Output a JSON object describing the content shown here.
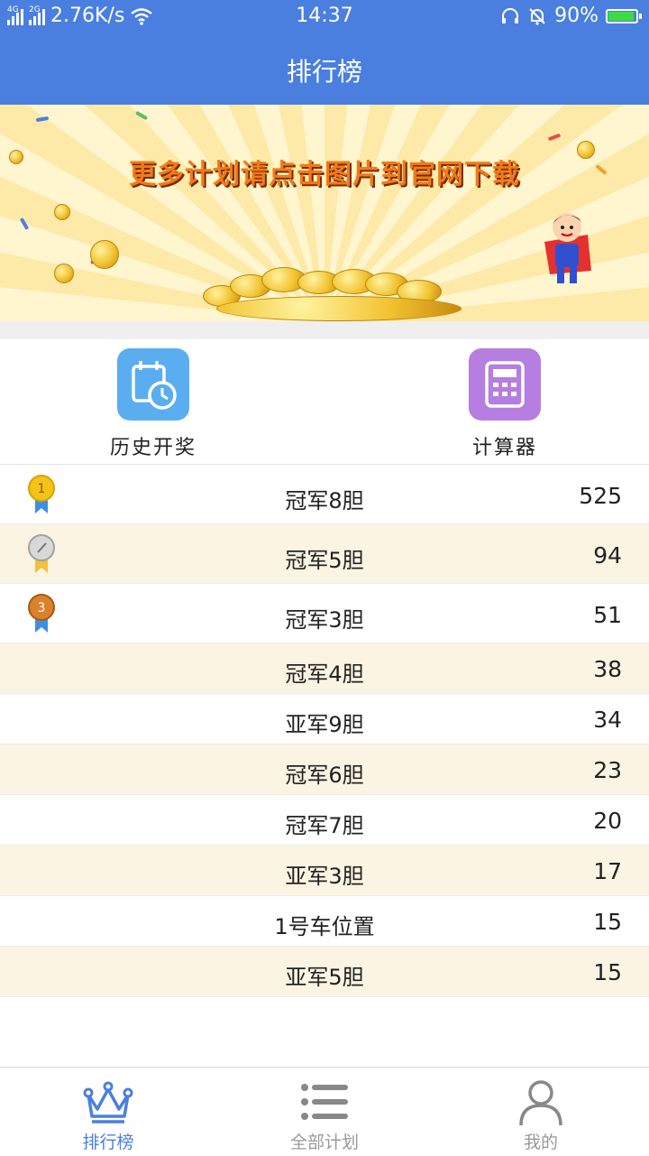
{
  "status_bar": {
    "network_left": "4G",
    "network_right": "2G",
    "speed": "2.76K/s",
    "time": "14:37",
    "battery": "90%",
    "icons": [
      "signal-icon",
      "wifi-icon",
      "headset-icon",
      "bell-muted-icon",
      "battery-icon"
    ]
  },
  "nav": {
    "title": "排行榜"
  },
  "banner": {
    "text": "更多计划请点击图片到官网下载"
  },
  "actions": [
    {
      "label": "历史开奖",
      "icon": "calendar-clock-icon",
      "color": "#5aaef0"
    },
    {
      "label": "计算器",
      "icon": "calculator-icon",
      "color": "#b57ee0"
    }
  ],
  "ranking": [
    {
      "name": "冠军8胆",
      "count": "525",
      "medal": "gold"
    },
    {
      "name": "冠军5胆",
      "count": "94",
      "medal": "silver"
    },
    {
      "name": "冠军3胆",
      "count": "51",
      "medal": "bronze"
    },
    {
      "name": "冠军4胆",
      "count": "38"
    },
    {
      "name": "亚军9胆",
      "count": "34"
    },
    {
      "name": "冠军6胆",
      "count": "23"
    },
    {
      "name": "冠军7胆",
      "count": "20"
    },
    {
      "name": "亚军3胆",
      "count": "17"
    },
    {
      "name": "1号车位置",
      "count": "15"
    },
    {
      "name": "亚军5胆",
      "count": "15"
    }
  ],
  "tabs": [
    {
      "label": "排行榜",
      "icon": "crown-icon",
      "active": true
    },
    {
      "label": "全部计划",
      "icon": "list-icon",
      "active": false
    },
    {
      "label": "我的",
      "icon": "user-icon",
      "active": false
    }
  ],
  "colors": {
    "primary": "#4a7fe0",
    "row_alt": "#fbf4e3",
    "inactive": "#999999"
  }
}
